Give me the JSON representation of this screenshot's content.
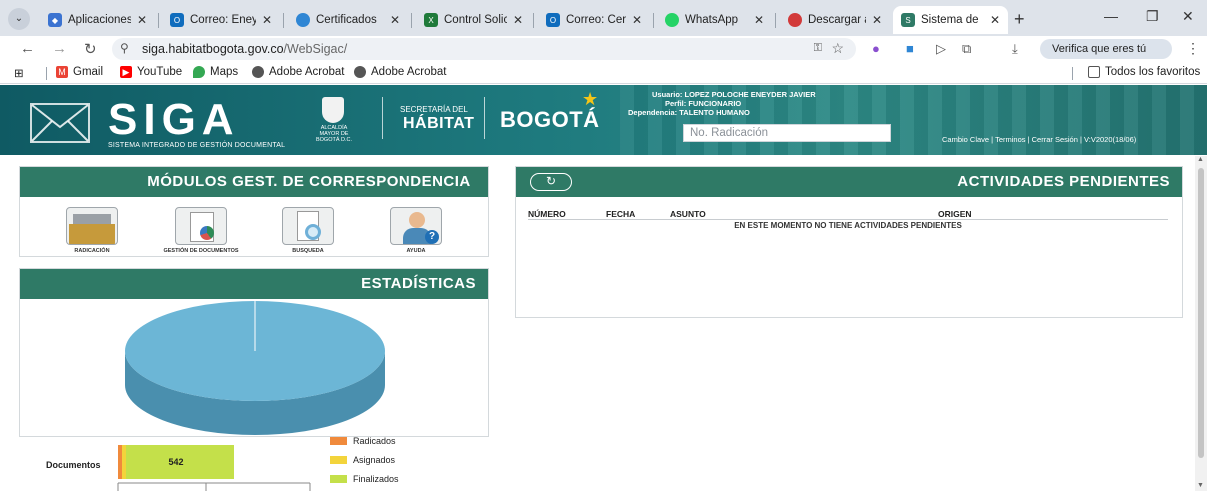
{
  "browser": {
    "tabs": [
      {
        "title": "Aplicaciones",
        "fav_color": "#3b73d1",
        "active": false
      },
      {
        "title": "Correo: Eney",
        "fav_color": "#0f6cbd",
        "active": false
      },
      {
        "title": "Certificados",
        "fav_color": "#2f86d4",
        "active": false
      },
      {
        "title": "Control Solic",
        "fav_color": "#1f7a3a",
        "active": false
      },
      {
        "title": "Correo: Cert",
        "fav_color": "#0f6cbd",
        "active": false
      },
      {
        "title": "WhatsApp",
        "fav_color": "#25d366",
        "active": false
      },
      {
        "title": "Descargar ar",
        "fav_color": "#d23a3a",
        "active": false
      },
      {
        "title": "Sistema de",
        "fav_color": "#2f7a66",
        "active": true
      }
    ],
    "url_host": "siga.habitatbogota.gov.co",
    "url_path": "/WebSigac/",
    "verify_label": "Verifica que eres tú",
    "bookmarks": [
      "Gmail",
      "YouTube",
      "Maps",
      "Adobe Acrobat",
      "Adobe Acrobat"
    ],
    "all_bookmarks": "Todos los favoritos"
  },
  "header": {
    "logo": "SIGA",
    "logo_sub": "SISTEMA INTEGRADO DE GESTIÓN DOCUMENTAL",
    "alcaldia": "ALCALDÍA MAYOR DE BOGOTÁ D.C.",
    "secretaria_small": "SECRETARÍA DEL",
    "secretaria_big": "HÁBITAT",
    "bogota": "BOGOTÁ",
    "user_line": "Usuario: LOPEZ POLOCHE ENEYDER JAVIER",
    "profile_line": "Perfil: FUNCIONARIO",
    "dept_line": "Dependencia: TALENTO HUMANO",
    "search_placeholder": "No. Radicación",
    "links": "Cambio Clave | Terminos | Cerrar Sesión | V:V2020(18/06)"
  },
  "modules": {
    "title": "MÓDULOS GEST. DE CORRESPONDENCIA",
    "items": [
      {
        "label": "RADICACIÓN"
      },
      {
        "label": "GESTIÓN DE DOCUMENTOS"
      },
      {
        "label": "BUSQUEDA"
      },
      {
        "label": "AYUDA"
      }
    ]
  },
  "stats": {
    "title": "ESTADÍSTICAS"
  },
  "activities": {
    "title": "ACTIVIDADES PENDIENTES",
    "columns": [
      "NÚMERO",
      "FECHA",
      "ASUNTO",
      "ORIGEN"
    ],
    "empty_message": "EN ESTE MOMENTO NO TIENE ACTIVIDADES PENDIENTES"
  },
  "chart_data": {
    "type": "bar",
    "categories": [
      "Documentos"
    ],
    "series": [
      {
        "name": "Radicados",
        "values": [
          0
        ],
        "color": "#f08a3c"
      },
      {
        "name": "Asignados",
        "values": [
          0
        ],
        "color": "#f3d43b"
      },
      {
        "name": "Finalizados",
        "values": [
          542
        ],
        "color": "#c4e04a"
      }
    ],
    "data_labels": [
      "542"
    ],
    "legend": "right",
    "pie_color": "#6cb6d6"
  }
}
